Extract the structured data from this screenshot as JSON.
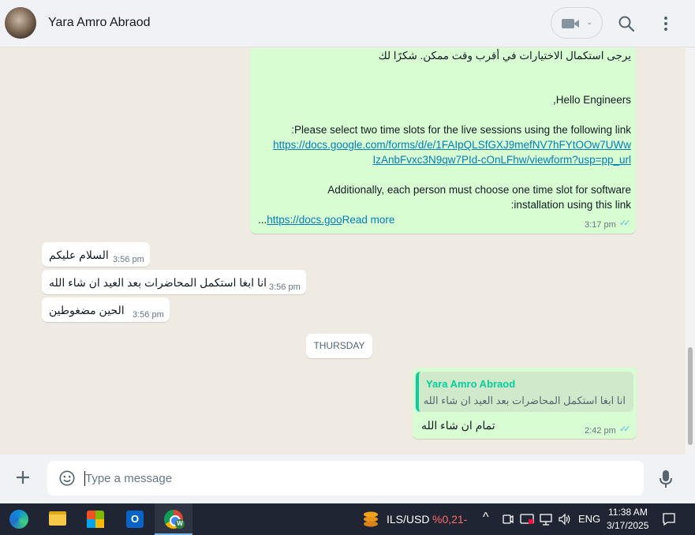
{
  "header": {
    "contact_name": "Yara Amro Abraod",
    "icons": [
      "video-call-icon",
      "chevron-down-icon",
      "search-icon",
      "menu-icon"
    ]
  },
  "messages": {
    "long": {
      "line1": "يرجى استكمال الاختيارات في أقرب وقت ممكن. شكرًا لك",
      "line2": "Hello Engineers,",
      "line3": "Please select two time slots for the live sessions using the following link:",
      "link_part1": "https://docs.google.com/forms/d/e/1FAIpQLSfGXJ9mefNV7hFYtOOw7UWw",
      "link_part2": "IzAnbFvxc3N9qw7PId-cOnLFhw/viewform?usp=pp_url",
      "line4": "Additionally, each person must choose one time slot for software",
      "line5": "installation using this link:",
      "link_short": "https://docs.goo",
      "ellipsis": "...",
      "read_more": "Read more",
      "time": "3:17 pm"
    },
    "in1": {
      "text": "السلام عليكم",
      "time": "3:56 pm"
    },
    "in2": {
      "text": "انا ابغا استكمل المحاضرات بعد العيد ان شاء الله",
      "time": "3:56 pm"
    },
    "in3": {
      "text": "الحين مضغوطين",
      "time": "3:56 pm"
    },
    "date_divider": "THURSDAY",
    "reply": {
      "quote_name": "Yara Amro Abraod",
      "quote_text": "انا ابغا استكمل المحاضرات بعد العيد ان شاء الله",
      "text": "تمام ان شاء الله",
      "time": "2:42 pm"
    }
  },
  "composer": {
    "placeholder": "Type a message",
    "value": "",
    "icons": [
      "plus-icon",
      "emoji-icon",
      "mic-icon"
    ]
  },
  "taskbar": {
    "apps": [
      "edge-icon",
      "file-explorer-icon",
      "store-icon",
      "outlook-icon",
      "chrome-icon"
    ],
    "chrome_badge": "W",
    "currency_label": "ILS/USD",
    "currency_change": "-0,21%",
    "language": "ENG",
    "time": "11:38 AM",
    "date": "3/17/2025",
    "colors": {
      "currency_change": "#ff6b6b",
      "taskbar_bg": "#1f2532"
    }
  },
  "colors": {
    "accent": "#06cf9c",
    "outgoing_bubble": "#d9fdd3",
    "link": "#027eb5",
    "read_ticks": "#53bdeb"
  }
}
